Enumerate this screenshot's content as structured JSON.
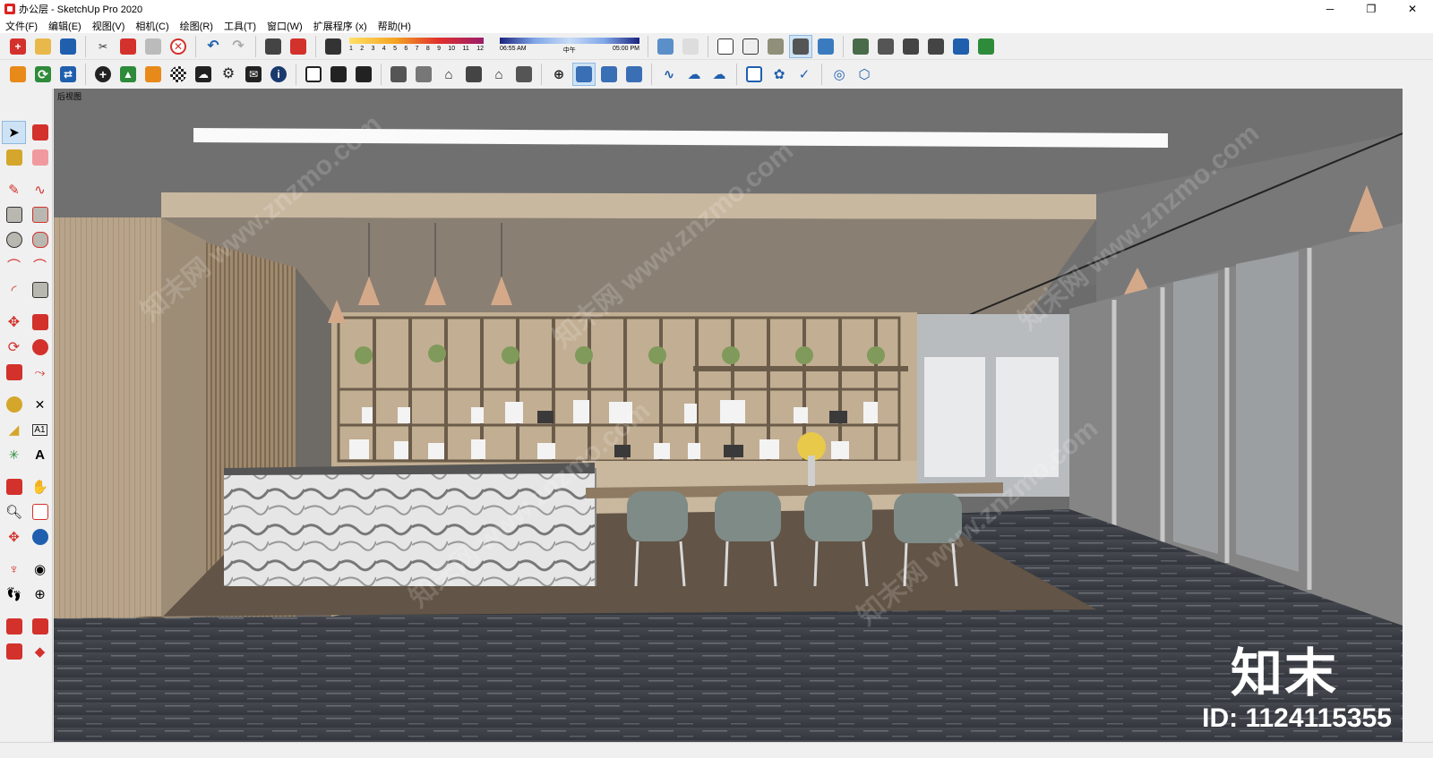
{
  "window": {
    "title": "办公层 - SketchUp Pro 2020",
    "controls": {
      "minimize": "─",
      "maximize": "❐",
      "close": "✕"
    }
  },
  "menu": [
    "文件(F)",
    "编辑(E)",
    "视图(V)",
    "相机(C)",
    "绘图(R)",
    "工具(T)",
    "窗口(W)",
    "扩展程序 (x)",
    "帮助(H)"
  ],
  "shadow_settings": {
    "months": [
      "1",
      "2",
      "3",
      "4",
      "5",
      "6",
      "7",
      "8",
      "9",
      "10",
      "11",
      "12"
    ],
    "time_start": "06:55 AM",
    "time_mid": "中午",
    "time_end": "05:00 PM"
  },
  "viewport": {
    "scene_tab": "后视图"
  },
  "watermark": {
    "text": "知末网 www.znzmo.com",
    "logo": "知末",
    "id_text": "ID: 1124115355"
  },
  "icons": {
    "toolbar1": [
      "new-model-icon",
      "open-icon",
      "save-icon",
      "cut-icon",
      "copy-icon",
      "paste-icon",
      "erase-icon",
      "undo-icon",
      "redo-icon",
      "print-icon",
      "model-info-icon"
    ],
    "toolbar2": [
      "extension-warehouse-icon",
      "refresh-icon",
      "transfer-icon",
      "add-icon",
      "tree-icon",
      "sandbox-icon",
      "checker-icon",
      "cloud-upload-icon",
      "settings-icon",
      "mail-icon",
      "info-icon"
    ],
    "colors": {
      "red": "#d3312c",
      "blue": "#1f5fae",
      "green": "#2e8b3a",
      "orange": "#e88a1a",
      "dark": "#222222"
    }
  }
}
